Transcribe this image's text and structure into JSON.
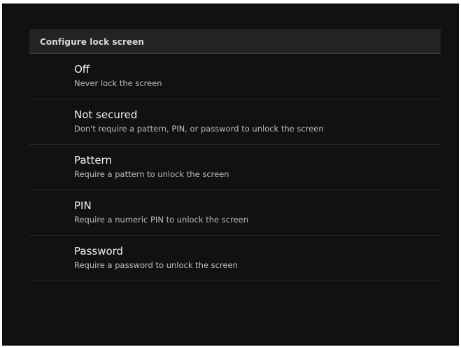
{
  "header": {
    "title": "Configure lock screen"
  },
  "options": [
    {
      "title": "Off",
      "summary": "Never lock the screen"
    },
    {
      "title": "Not secured",
      "summary": "Don't require a pattern, PIN, or password to unlock the screen"
    },
    {
      "title": "Pattern",
      "summary": "Require a pattern to unlock the screen"
    },
    {
      "title": "PIN",
      "summary": "Require a numeric PIN to unlock the screen"
    },
    {
      "title": "Password",
      "summary": "Require a password to unlock the screen"
    }
  ],
  "colors": {
    "background": "#111111",
    "header_background": "#232323",
    "title_text": "#f2f2f2",
    "summary_text": "#bdbdbd",
    "divider": "#262626"
  }
}
